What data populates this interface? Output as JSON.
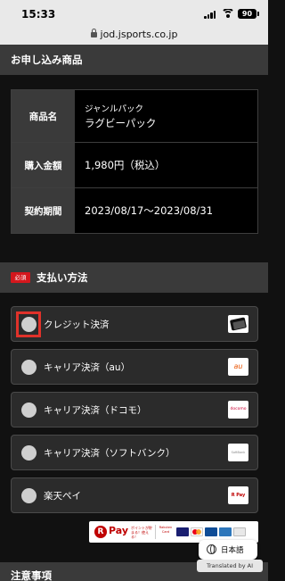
{
  "status_bar": {
    "time": "15:33",
    "battery": "90"
  },
  "browser": {
    "url": "jod.jsports.co.jp"
  },
  "order_section": {
    "title": "お申し込み商品",
    "rows": [
      {
        "label": "商品名",
        "sub_value": "ジャンルパック",
        "value": "ラグビーパック"
      },
      {
        "label": "購入金額",
        "value": "1,980円（税込）"
      },
      {
        "label": "契約期間",
        "value": "2023/08/17〜2023/08/31"
      }
    ]
  },
  "payment_section": {
    "required_badge": "必須",
    "title": "支払い方法",
    "options": [
      {
        "label": "クレジット決済",
        "logo_icon": "credit-card-icon"
      },
      {
        "label": "キャリア決済（au）",
        "logo_text": "au",
        "logo_color": "#ea5504"
      },
      {
        "label": "キャリア決済（ドコモ）",
        "logo_text": "docomo",
        "logo_color": "#cc0033"
      },
      {
        "label": "キャリア決済（ソフトバンク）",
        "logo_text": "SoftBank",
        "logo_color": "#888888"
      },
      {
        "label": "楽天ペイ",
        "logo_text": "R Pay",
        "logo_color": "#bf0000"
      }
    ],
    "card_strip": {
      "rpay_text": "Pay",
      "rpay_small": "ポイントが貯まる！使える！",
      "rakuten_card": "Rakuten Card"
    }
  },
  "translation": {
    "language": "日本語",
    "note": "Translated by AI"
  },
  "next_section": {
    "title": "注意事項"
  },
  "colors": {
    "highlight": "#e0322a",
    "required": "#d4171d",
    "rakuten": "#bf0000"
  }
}
